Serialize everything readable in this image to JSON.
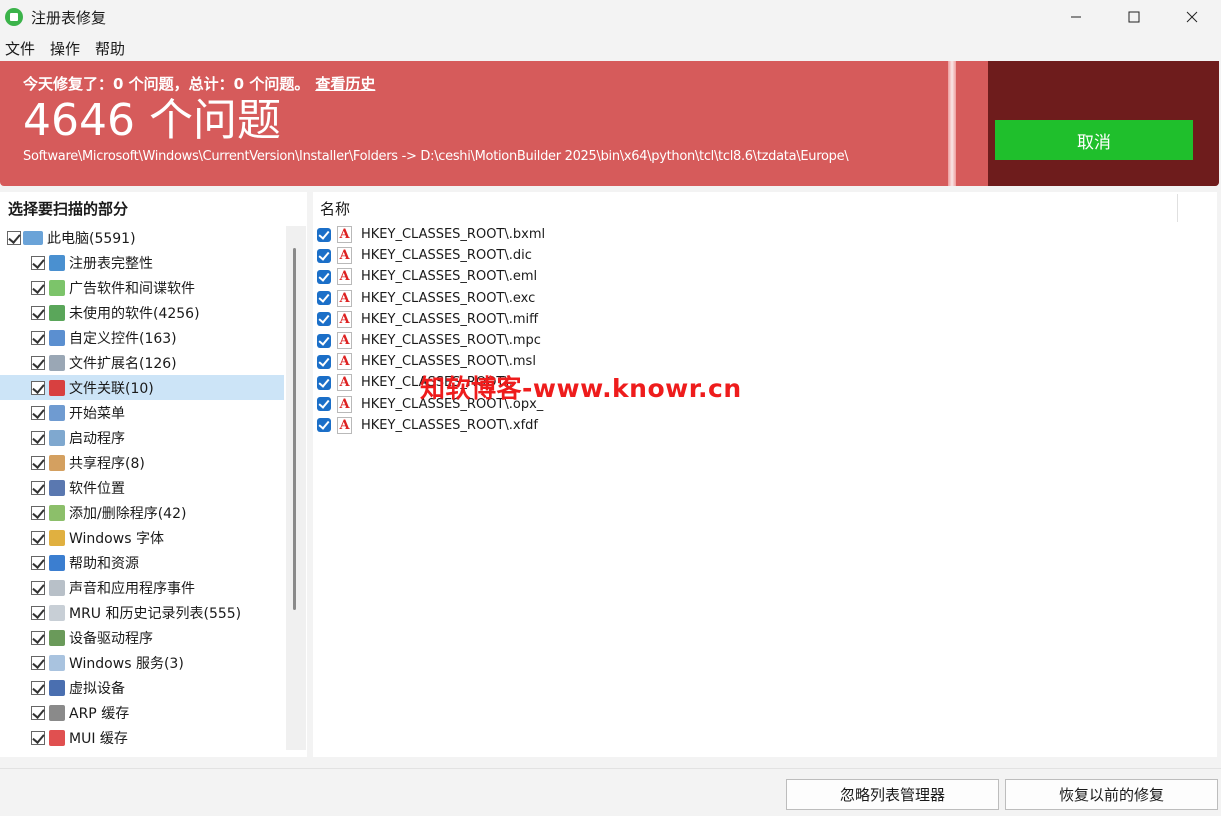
{
  "window": {
    "title": "注册表修复",
    "controls": [
      "minimize-icon",
      "maximize-icon",
      "close-icon"
    ]
  },
  "menu": [
    "文件",
    "操作",
    "帮助"
  ],
  "banner": {
    "today_text": "今天修复了：0 个问题，总计：0 个问题。",
    "history_link": "查看历史",
    "issue_count": "4646 个问题",
    "current_path": "Software\\Microsoft\\Windows\\CurrentVersion\\Installer\\Folders -> D:\\ceshi\\MotionBuilder 2025\\bin\\x64\\python\\tcl\\tcl8.6\\tzdata\\Europe\\",
    "cancel_label": "取消",
    "colors": {
      "banner": "#d65b5b",
      "dark_panel": "#6e1c1c",
      "cancel_button": "#1fbf2c"
    }
  },
  "left_panel": {
    "header": "选择要扫描的部分",
    "tree": [
      {
        "label": "此电脑(5591)",
        "icon": "computer-icon",
        "level": 0,
        "checked": true,
        "selected": false
      },
      {
        "label": "注册表完整性",
        "icon": "registry-icon",
        "level": 1,
        "checked": true,
        "selected": false
      },
      {
        "label": "广告软件和间谍软件",
        "icon": "shield-icon",
        "level": 1,
        "checked": true,
        "selected": false
      },
      {
        "label": "未使用的软件(4256)",
        "icon": "recycle-bin-icon",
        "level": 1,
        "checked": true,
        "selected": false
      },
      {
        "label": "自定义控件(163)",
        "icon": "controls-icon",
        "level": 1,
        "checked": true,
        "selected": false
      },
      {
        "label": "文件扩展名(126)",
        "icon": "file-extension-icon",
        "level": 1,
        "checked": true,
        "selected": false
      },
      {
        "label": "文件关联(10)",
        "icon": "file-association-icon",
        "level": 1,
        "checked": true,
        "selected": true
      },
      {
        "label": "开始菜单",
        "icon": "start-menu-icon",
        "level": 1,
        "checked": true,
        "selected": false
      },
      {
        "label": "启动程序",
        "icon": "startup-icon",
        "level": 1,
        "checked": true,
        "selected": false
      },
      {
        "label": "共享程序(8)",
        "icon": "shared-program-icon",
        "level": 1,
        "checked": true,
        "selected": false
      },
      {
        "label": "软件位置",
        "icon": "software-location-icon",
        "level": 1,
        "checked": true,
        "selected": false
      },
      {
        "label": "添加/删除程序(42)",
        "icon": "add-remove-icon",
        "level": 1,
        "checked": true,
        "selected": false
      },
      {
        "label": "Windows 字体",
        "icon": "font-icon",
        "level": 1,
        "checked": true,
        "selected": false
      },
      {
        "label": "帮助和资源",
        "icon": "help-icon",
        "level": 1,
        "checked": true,
        "selected": false
      },
      {
        "label": "声音和应用程序事件",
        "icon": "sound-icon",
        "level": 1,
        "checked": true,
        "selected": false
      },
      {
        "label": "MRU 和历史记录列表(555)",
        "icon": "history-icon",
        "level": 1,
        "checked": true,
        "selected": false
      },
      {
        "label": "设备驱动程序",
        "icon": "driver-icon",
        "level": 1,
        "checked": true,
        "selected": false
      },
      {
        "label": "Windows 服务(3)",
        "icon": "service-icon",
        "level": 1,
        "checked": true,
        "selected": false
      },
      {
        "label": "虚拟设备",
        "icon": "virtual-device-icon",
        "level": 1,
        "checked": true,
        "selected": false
      },
      {
        "label": "ARP 缓存",
        "icon": "arp-cache-icon",
        "level": 1,
        "checked": true,
        "selected": false
      },
      {
        "label": "MUI 缓存",
        "icon": "mui-cache-icon",
        "level": 1,
        "checked": true,
        "selected": false
      }
    ]
  },
  "right_panel": {
    "column_header": "名称",
    "entries": [
      "HKEY_CLASSES_ROOT\\.bxml",
      "HKEY_CLASSES_ROOT\\.dic",
      "HKEY_CLASSES_ROOT\\.eml",
      "HKEY_CLASSES_ROOT\\.exc",
      "HKEY_CLASSES_ROOT\\.miff",
      "HKEY_CLASSES_ROOT\\.mpc",
      "HKEY_CLASSES_ROOT\\.msl",
      "HKEY_CLASSES_ROOT\\.",
      "HKEY_CLASSES_ROOT\\.opx_",
      "HKEY_CLASSES_ROOT\\.xfdf"
    ]
  },
  "watermark": "知软博客-www.knowr.cn",
  "footer": {
    "ignore_list_button": "忽略列表管理器",
    "restore_button": "恢复以前的修复"
  }
}
